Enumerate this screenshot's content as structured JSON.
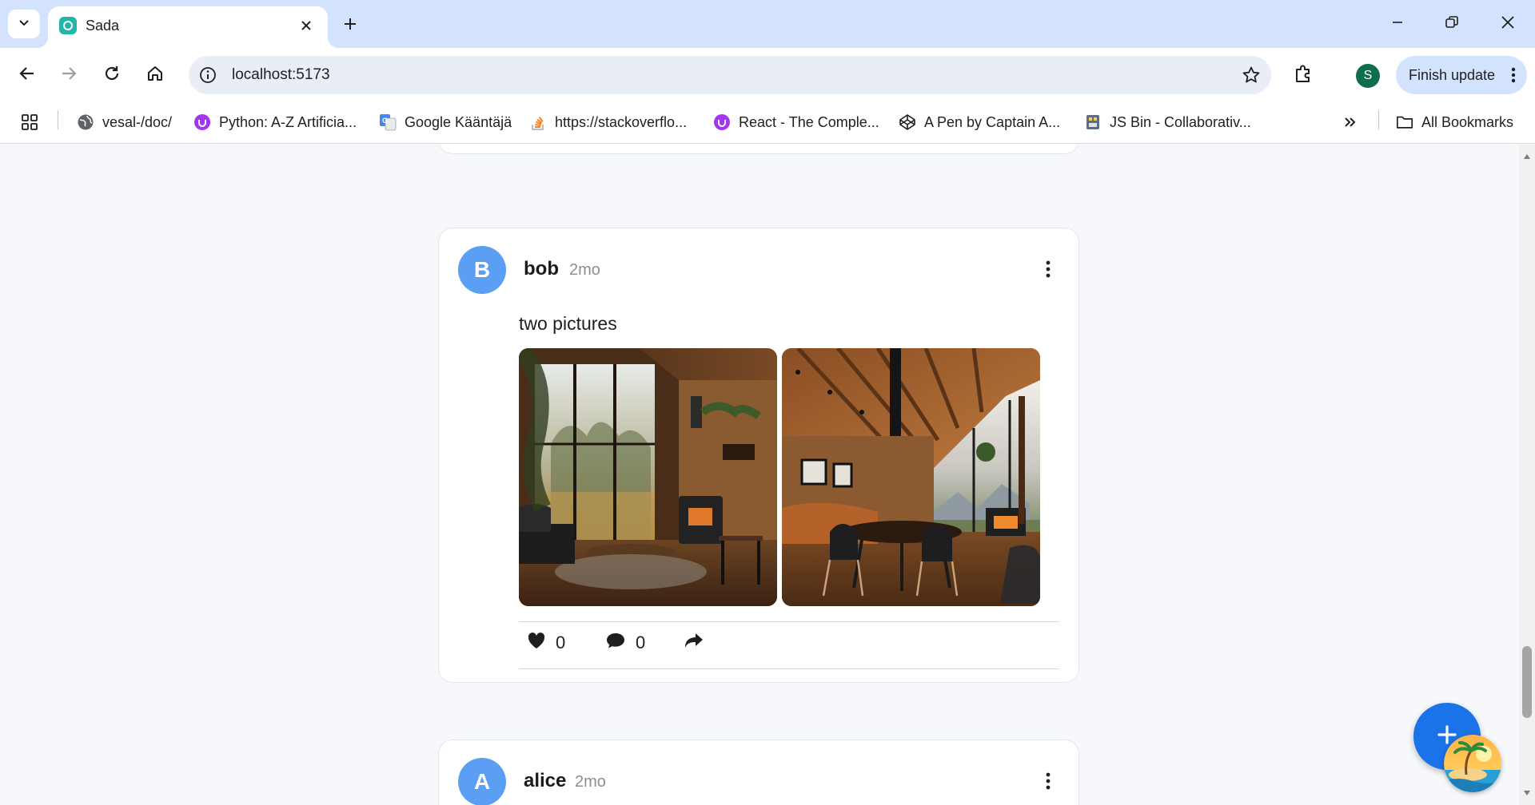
{
  "browser": {
    "tab_title": "Sada",
    "url": "localhost:5173",
    "profile_initial": "S",
    "finish_update_label": "Finish update",
    "bookmarks": [
      {
        "label": "vesal-/doc/",
        "icon": "globe-icon"
      },
      {
        "label": "Python: A-Z Artificia...",
        "icon": "udemy-icon"
      },
      {
        "label": "Google Kääntäjä",
        "icon": "google-translate-icon"
      },
      {
        "label": "https://stackoverflo...",
        "icon": "stackoverflow-icon"
      },
      {
        "label": "React - The Comple...",
        "icon": "udemy-icon"
      },
      {
        "label": "A Pen by Captain A...",
        "icon": "codepen-icon"
      },
      {
        "label": "JS Bin - Collaborativ...",
        "icon": "jsbin-icon"
      }
    ],
    "all_bookmarks_label": "All Bookmarks"
  },
  "feed": {
    "posts": [
      {
        "avatar_initial": "B",
        "username": "bob",
        "time": "2mo",
        "text": "two pictures",
        "likes": "0",
        "comments": "0"
      },
      {
        "avatar_initial": "A",
        "username": "alice",
        "time": "2mo"
      }
    ]
  },
  "colors": {
    "avatar": "#5b9ff5",
    "fab": "#1a73e8",
    "accent_tabstrip": "#d3e3fd"
  }
}
